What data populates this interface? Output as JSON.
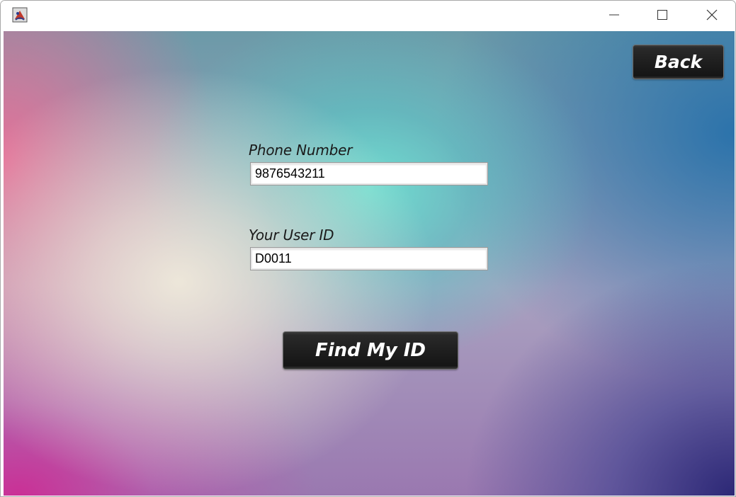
{
  "titlebar": {
    "app_icon": "java-app-icon",
    "minimize_icon": "minimize-icon",
    "maximize_icon": "maximize-icon",
    "close_icon": "close-icon"
  },
  "form": {
    "phone_label": "Phone Number",
    "phone_value": "9876543211",
    "userid_label": "Your User ID",
    "userid_value": "D0011"
  },
  "buttons": {
    "back_label": "Back",
    "find_label": "Find My ID"
  },
  "colors": {
    "button_bg": "#1f1f1f",
    "button_text": "#ffffff",
    "label_text": "#1a1a1a"
  }
}
